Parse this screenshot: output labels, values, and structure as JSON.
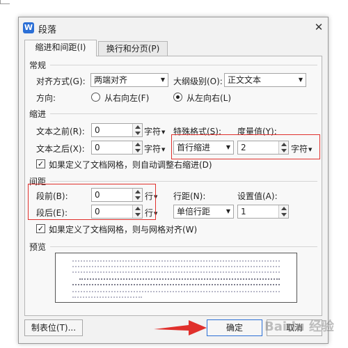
{
  "window": {
    "title": "段落",
    "app_icon_letter": "W",
    "close_symbol": "✕"
  },
  "tabs": [
    {
      "label": "缩进和间距(I)",
      "active": true
    },
    {
      "label": "换行和分页(P)",
      "active": false
    }
  ],
  "general": {
    "section_title": "常规",
    "alignment_label": "对齐方式(G):",
    "alignment_value": "两端对齐",
    "outline_label": "大纲级别(O):",
    "outline_value": "正文文本",
    "direction_label": "方向:",
    "rtl_label": "从右向左(F)",
    "ltr_label": "从左向右(L)",
    "ltr_selected": true
  },
  "indent": {
    "section_title": "缩进",
    "before_label": "文本之前(R):",
    "before_value": "0",
    "after_label": "文本之后(X):",
    "after_value": "0",
    "unit": "字符",
    "special_label": "特殊格式(S):",
    "special_value": "首行缩进",
    "amount_label": "度量值(Y):",
    "amount_value": "2",
    "grid_checkbox_label": "如果定义了文档网格，则自动调整右缩进(D)",
    "grid_checked": true
  },
  "spacing": {
    "section_title": "间距",
    "before_label": "段前(B):",
    "before_value": "0",
    "after_label": "段后(E):",
    "after_value": "0",
    "unit": "行",
    "line_label": "行距(N):",
    "line_value": "单倍行距",
    "setting_label": "设置值(A):",
    "setting_value": "1",
    "grid_checkbox_label": "如果定义了文档网格，则与网格对齐(W)",
    "grid_checked": true
  },
  "preview": {
    "section_title": "预览"
  },
  "footer": {
    "tabs_button": "制表位(T)...",
    "ok_button": "确定",
    "cancel_button": "取消"
  },
  "colors": {
    "highlight": "#e0302c",
    "accent": "#2b6fd6"
  },
  "watermark": "Baidu 经验"
}
